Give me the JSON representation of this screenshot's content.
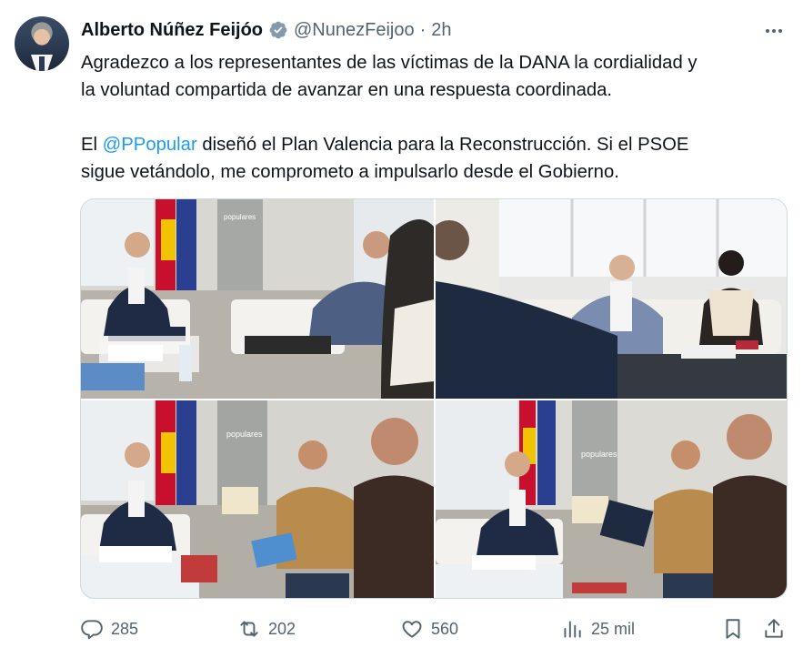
{
  "author": {
    "name": "Alberto Núñez Feijóo",
    "handle": "@NunezFeijoo",
    "separator": "·",
    "time": "2h"
  },
  "post": {
    "line1": "Agradezco a los representantes de las víctimas de la DANA la cordialidad y",
    "line2": "la voluntad compartida de avanzar en una respuesta coordinada.",
    "line3_prefix": "El ",
    "line3_mention": "@PPopular",
    "line3_suffix": " diseñó el Plan Valencia para la Reconstrucción. Si el PSOE",
    "line4": "sigue vetándolo, me comprometo a impulsarlo desde el Gobierno."
  },
  "media": {
    "photo_label": "populares"
  },
  "actions": {
    "replies": "285",
    "reposts": "202",
    "likes": "560",
    "views": "25 mil"
  },
  "colors": {
    "accent": "#1d9bf0",
    "muted": "#536471",
    "text": "#0f1419"
  },
  "icons": [
    "verified-badge-icon",
    "more-options-icon",
    "reply-icon",
    "repost-icon",
    "like-icon",
    "views-icon",
    "bookmark-icon",
    "share-icon"
  ]
}
